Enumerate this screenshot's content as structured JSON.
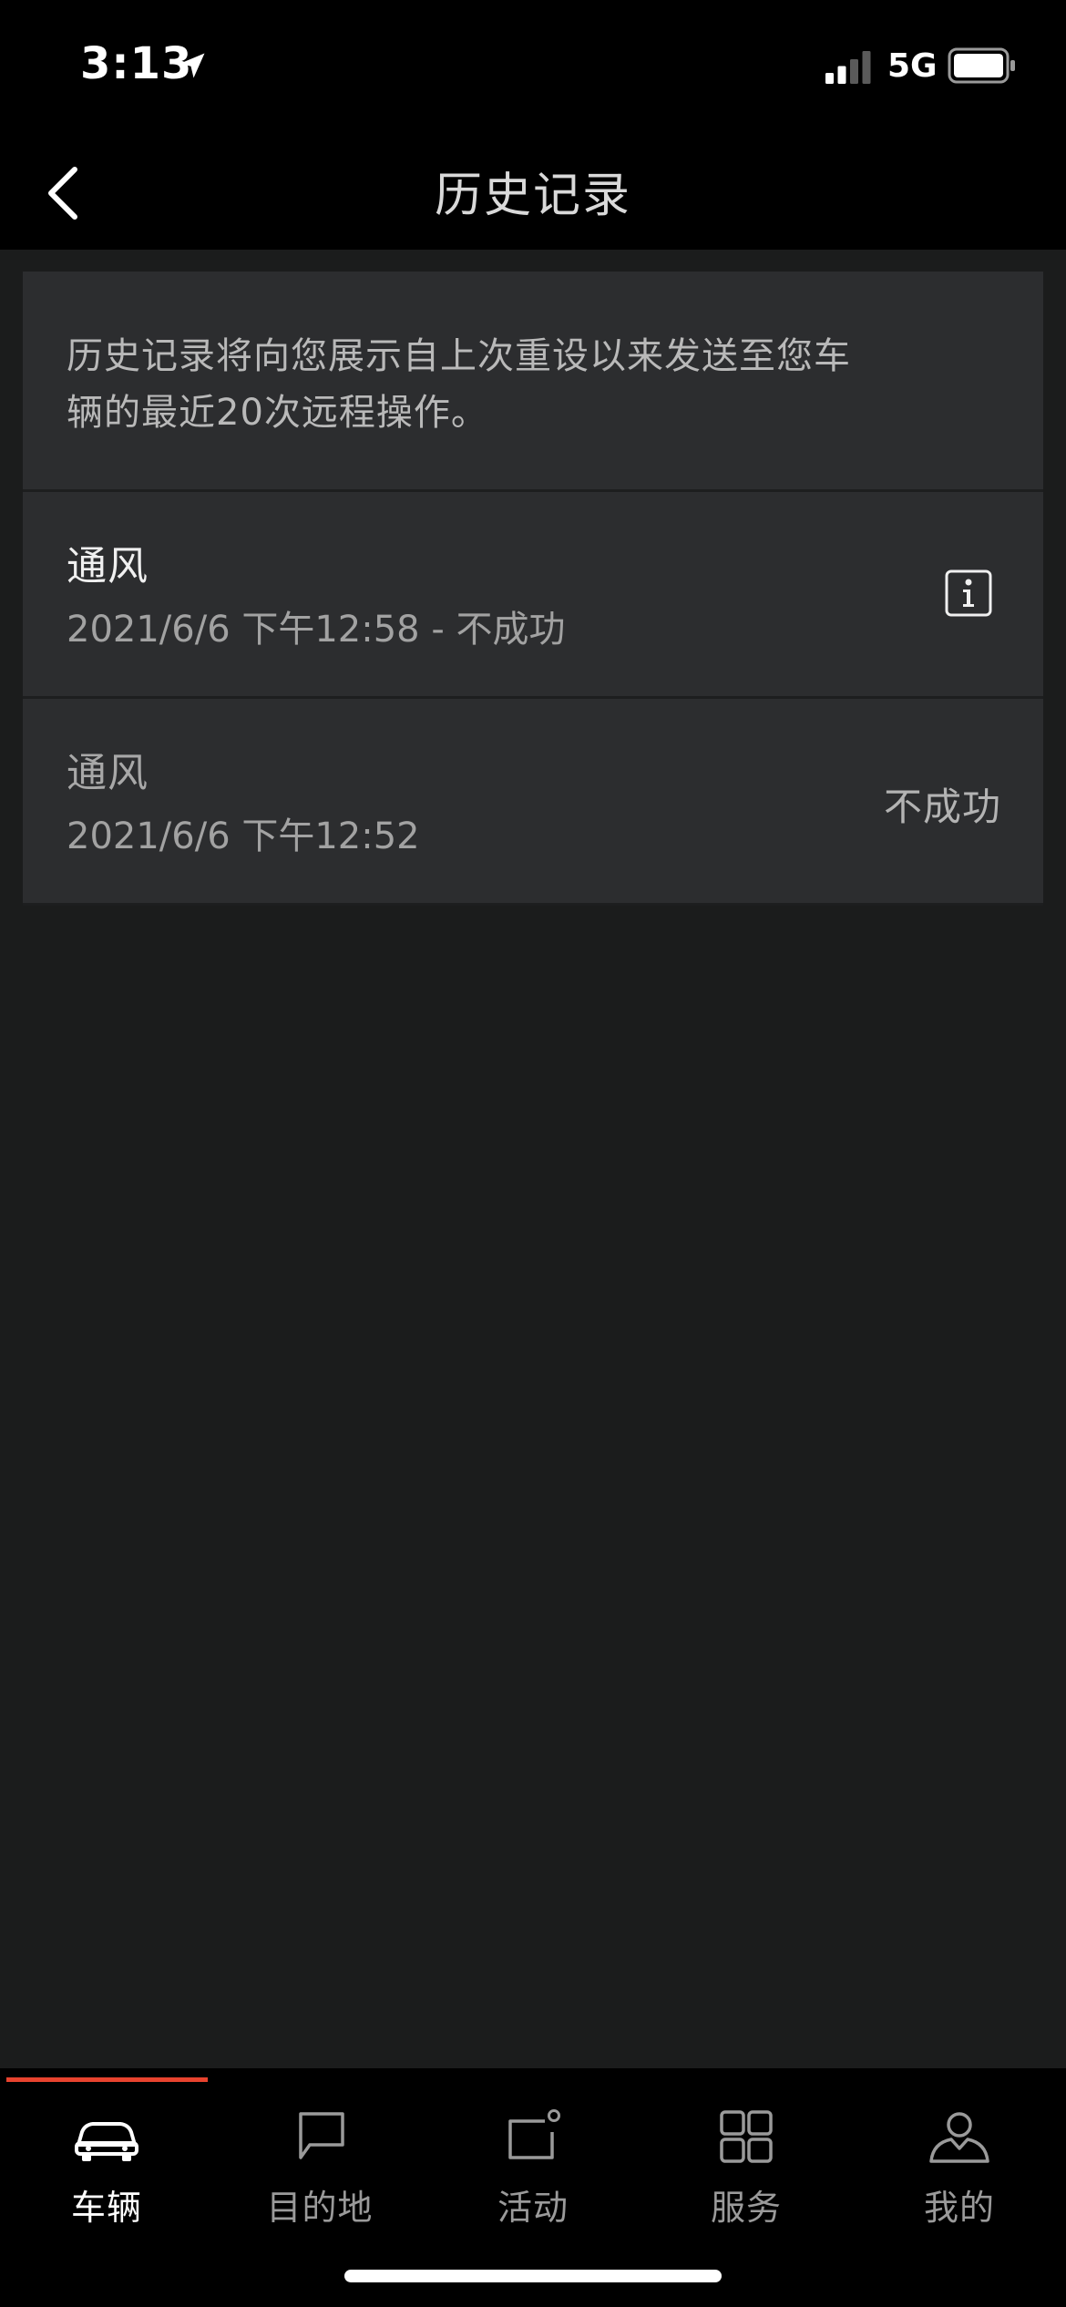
{
  "status_bar": {
    "time": "3:13",
    "network": "5G",
    "location_icon": "location-arrow-icon",
    "signal_icon": "cellular-signal-icon",
    "battery_icon": "battery-icon"
  },
  "nav": {
    "title": "历史记录",
    "back_icon": "chevron-left-icon"
  },
  "intro": {
    "text": "历史记录将向您展示自上次重设以来发送至您车\n辆的最近20次远程操作。"
  },
  "history": [
    {
      "title": "通风",
      "subtitle": "2021/6/6 下午12:58 - 不成功",
      "trailing_icon": "info-icon"
    },
    {
      "title": "通风",
      "subtitle": "2021/6/6 下午12:52",
      "status": "不成功"
    }
  ],
  "tabs": [
    {
      "label": "车辆",
      "icon": "car-icon",
      "active": true
    },
    {
      "label": "目的地",
      "icon": "chat-bubble-icon",
      "active": false
    },
    {
      "label": "活动",
      "icon": "notification-square-icon",
      "active": false
    },
    {
      "label": "服务",
      "icon": "grid-icon",
      "active": false
    },
    {
      "label": "我的",
      "icon": "user-icon",
      "active": false
    }
  ],
  "colors": {
    "accent": "#e8432e",
    "background": "#1b1c1c",
    "card": "#2c2d2f"
  }
}
